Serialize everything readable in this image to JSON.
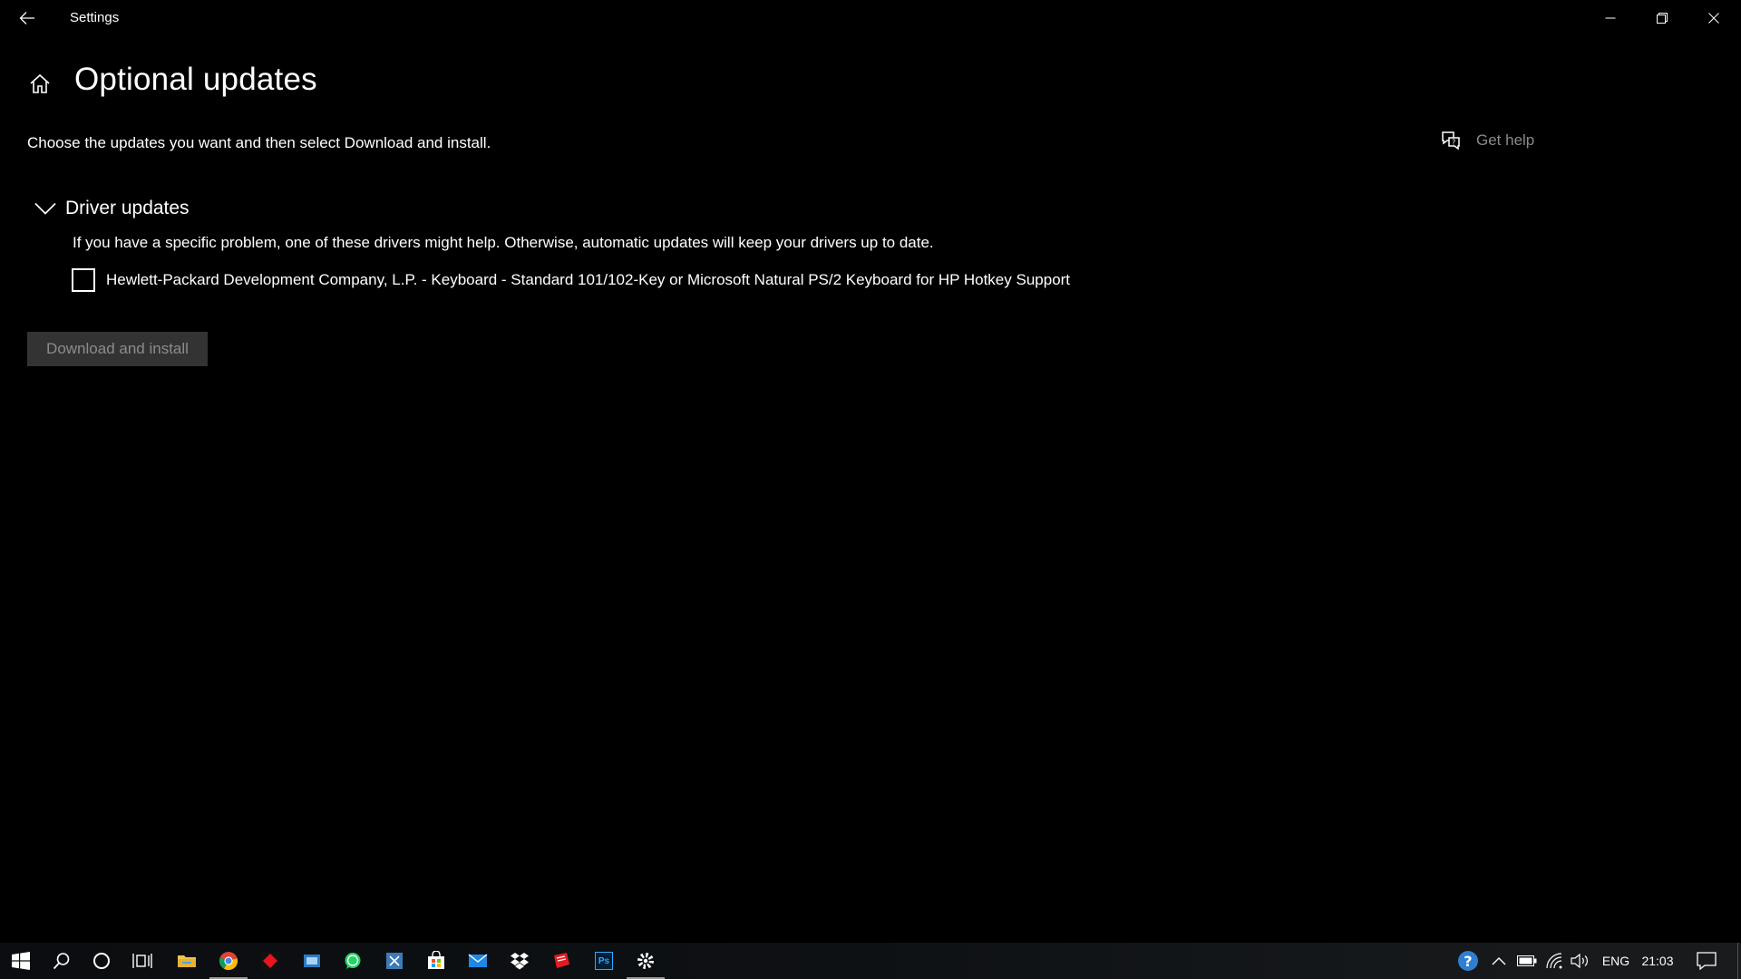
{
  "window": {
    "title": "Settings"
  },
  "header": {
    "title": "Optional updates",
    "subtitle": "Choose the updates you want and then select Download and install."
  },
  "help": {
    "label": "Get help"
  },
  "driver_updates": {
    "title": "Driver updates",
    "description": "If you have a specific problem, one of these drivers might help. Otherwise, automatic updates will keep your drivers up to date.",
    "items": [
      {
        "label": "Hewlett-Packard Development Company, L.P. - Keyboard - Standard 101/102-Key or Microsoft Natural PS/2 Keyboard for HP Hotkey Support",
        "checked": false
      }
    ]
  },
  "actions": {
    "download_label": "Download and install",
    "download_enabled": false
  },
  "taskbar": {
    "apps": [
      "start-icon",
      "search-icon",
      "cortana-icon",
      "task-view-icon",
      "file-explorer-icon",
      "chrome-icon",
      "red-app-icon",
      "app-blue-icon",
      "whatsapp-icon",
      "snipping-tool-icon",
      "store-icon",
      "mail-icon",
      "dropbox-icon",
      "red-book-icon",
      "photoshop-icon",
      "settings-icon"
    ],
    "ps_label": "Ps",
    "language": "ENG",
    "time": "21:03"
  },
  "colors": {
    "background": "#000000",
    "muted_text": "#8a8a8a",
    "disabled_button_bg": "#333333",
    "disabled_button_text": "#8c8c8c"
  }
}
